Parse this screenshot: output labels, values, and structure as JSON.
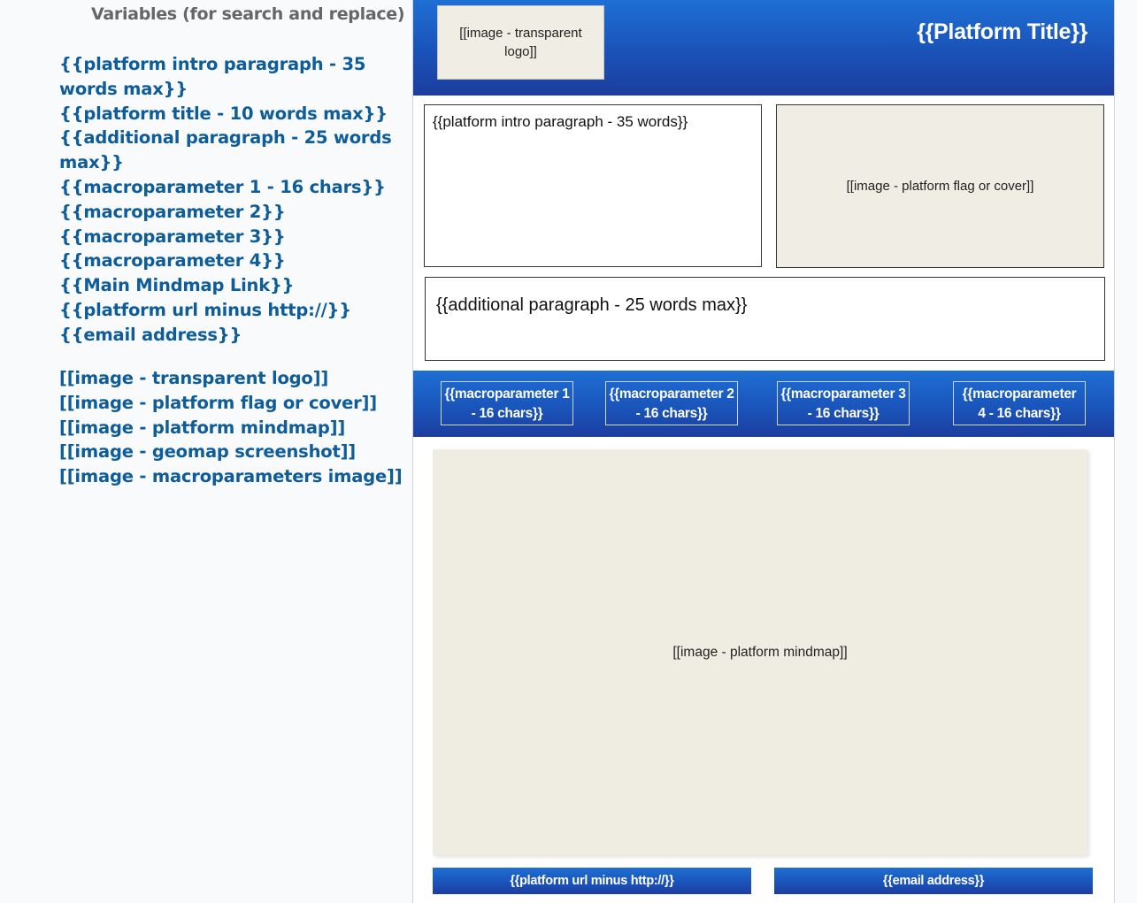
{
  "variables_panel": {
    "heading": "Variables (for search and replace)",
    "text_variables": [
      "{{platform intro paragraph - 35 words max}}",
      "{{platform title - 10 words max}}",
      "{{additional paragraph - 25 words max}}",
      "{{macroparameter 1 - 16 chars}}",
      "{{macroparameter 2}}",
      "{{macroparameter 3}}",
      "{{macroparameter 4}}",
      "{{Main Mindmap Link}}",
      "{{platform url minus http://}}",
      "{{email address}}"
    ],
    "image_variables": [
      "[[image - transparent logo]]",
      "[[image - platform flag or cover]]",
      "[[image - platform mindmap]]",
      "[[image - geomap screenshot]]",
      "[[image - macroparameters image]]"
    ]
  },
  "template": {
    "logo_placeholder": "[[image - transparent logo]]",
    "platform_title": "{{Platform Title}}",
    "intro_paragraph": "{{platform intro paragraph - 35 words}}",
    "flag_placeholder": "[[image - platform flag or cover]]",
    "additional_paragraph": "{{additional paragraph - 25 words max}}",
    "macroparameters": [
      {
        "line1": "{{macroparameter 1",
        "line2": "- 16 chars}}"
      },
      {
        "line1": "{{macroparameter 2",
        "line2": "- 16 chars}}"
      },
      {
        "line1": "{{macroparameter 3",
        "line2": "- 16 chars}}"
      },
      {
        "line1": "{{macroparameter",
        "line2": "4 - 16 chars}}"
      }
    ],
    "mindmap_placeholder": "[[image - platform mindmap]]",
    "url_button": "{{platform url minus http://}}",
    "email_button": "{{email address}}"
  },
  "colors": {
    "variable_text": "#0e5c99",
    "banner_blue": "#1a52b8",
    "placeholder_fill": "#efede4"
  }
}
